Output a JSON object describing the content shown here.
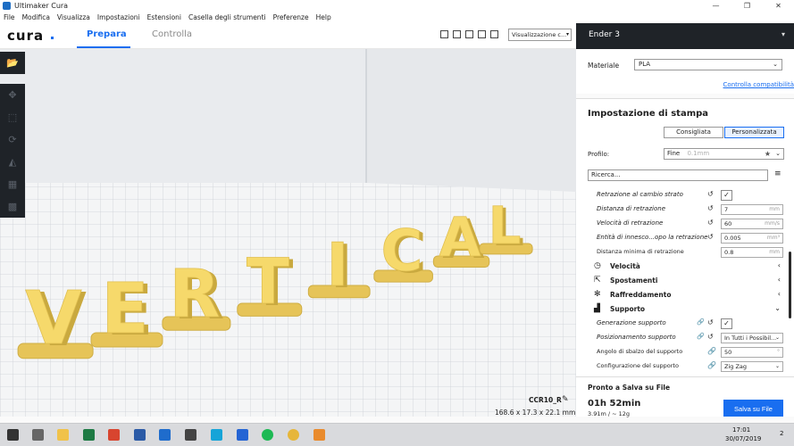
{
  "window": {
    "title": "Ultimaker Cura"
  },
  "menu": [
    "File",
    "Modifica",
    "Visualizza",
    "Impostazioni",
    "Estensioni",
    "Casella degli strumenti",
    "Preferenze",
    "Help"
  ],
  "header": {
    "logo": "cura",
    "tabs": [
      "Prepara",
      "Controlla"
    ],
    "active_tab": "Prepara",
    "view_select": "Visualizzazione c..."
  },
  "model": {
    "text": "VERTICAL",
    "letters": [
      "V",
      "E",
      "R",
      "T",
      "I",
      "C",
      "A",
      "L"
    ],
    "color": "#f6d96b"
  },
  "object": {
    "name": "CCR10_R",
    "dimensions": "168.6 x 17.3 x 22.1 mm"
  },
  "printer": {
    "name": "Ender 3"
  },
  "material": {
    "label": "Materiale",
    "value": "PLA",
    "compat_link": "Controlla compatibilità"
  },
  "settings": {
    "title": "Impostazione di stampa",
    "modes": [
      "Consigliata",
      "Personalizzata"
    ],
    "active_mode": "Personalizzata",
    "profile_label": "Profilo:",
    "profile_value": "Fine",
    "profile_sub": "0.1mm",
    "search_placeholder": "Ricerca...",
    "rows": [
      {
        "label": "Retrazione al cambio strato",
        "type": "checkbox",
        "value": "✓",
        "icon": "reset"
      },
      {
        "label": "Distanza di retrazione",
        "type": "field",
        "value": "7",
        "unit": "mm",
        "icon": "reset"
      },
      {
        "label": "Velocità di retrazione",
        "type": "field",
        "value": "60",
        "unit": "mm/s",
        "icon": "reset"
      },
      {
        "label": "Entità di innesco...opo la retrazione",
        "type": "field",
        "value": "0.005",
        "unit": "mm³",
        "icon": "reset"
      },
      {
        "label": "Distanza minima di retrazione",
        "type": "field",
        "value": "0.8",
        "unit": "mm",
        "plain": true
      }
    ],
    "categories": [
      {
        "label": "Velocità",
        "icon": "speed-icon",
        "expanded": false
      },
      {
        "label": "Spostamenti",
        "icon": "travel-icon",
        "expanded": false
      },
      {
        "label": "Raffreddamento",
        "icon": "fan-icon",
        "expanded": false
      },
      {
        "label": "Supporto",
        "icon": "support-icon",
        "expanded": true
      }
    ],
    "support_rows": [
      {
        "label": "Generazione supporto",
        "type": "checkbox",
        "value": "✓"
      },
      {
        "label": "Posizionamento supporto",
        "type": "combo",
        "value": "In Tutti i Possibil..."
      },
      {
        "label": "Angolo di sbalzo del supporto",
        "type": "field",
        "value": "50",
        "unit": "°",
        "plain": true
      },
      {
        "label": "Configurazione del supporto",
        "type": "combo",
        "value": "Zig Zag",
        "plain": true
      }
    ]
  },
  "output": {
    "status": "Pronto a Salva su File",
    "time": "01h 52min",
    "material_use": "3.91m / ~ 12g",
    "save_label": "Salva su File"
  },
  "taskbar": {
    "time": "17:01",
    "date": "30/07/2019",
    "notif": "2"
  }
}
